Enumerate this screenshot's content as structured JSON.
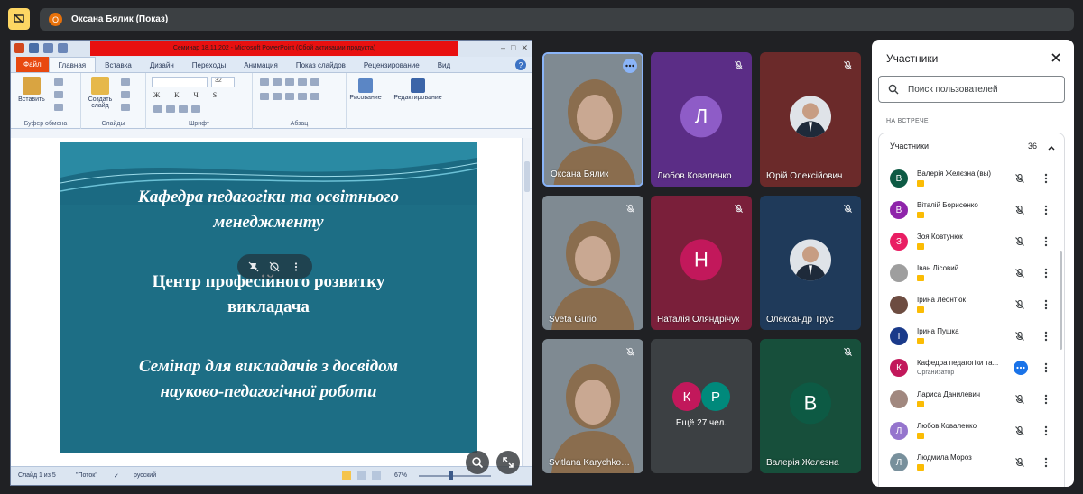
{
  "topbar": {
    "presenter_initial": "О",
    "presenter_label": "Оксана Бялик (Показ)"
  },
  "powerpoint": {
    "window_title": "Семинар     18.11.202  -  Microsoft PowerPoint (Сбой активации продукта)",
    "tabs": [
      "Файл",
      "Главная",
      "Вставка",
      "Дизайн",
      "Переходы",
      "Анимация",
      "Показ слайдов",
      "Рецензирование",
      "Вид"
    ],
    "active_tab": "Главная",
    "help": "?",
    "ribbon": {
      "paste": "Вставить",
      "create_slide_l1": "Создать",
      "create_slide_l2": "слайд",
      "drawing": "Рисование",
      "editing": "Редактирование",
      "font_size": "32",
      "groups": [
        "Буфер обмена",
        "Слайды",
        "Шрифт",
        "Абзац"
      ]
    },
    "slide": {
      "line1a": "Кафедра педагогіки та освітнього",
      "line1b": "менеджменту",
      "line2a": "Центр професійного  розвитку",
      "line2b": "викладача",
      "line3a": "Семінар для викладачів з досвідом",
      "line3b": "науково-педагогічної роботи"
    },
    "status": {
      "slide_of": "Слайд 1 из 5",
      "theme": "\"Поток\"",
      "language": "русский",
      "zoom": "67%"
    }
  },
  "tiles": [
    {
      "name": "Оксана Бялик",
      "type": "photo",
      "highlight": true
    },
    {
      "name": "Любов Коваленко",
      "type": "avatar",
      "initial": "Л",
      "bg": "#5b2d86",
      "avatar_color": "#8e5cc7"
    },
    {
      "name": "Юрій Олексійович",
      "type": "photo-small",
      "bg": "#6b2a2a"
    },
    {
      "name": "Sveta Gurio",
      "type": "photo"
    },
    {
      "name": "Наталія Оляндрічук",
      "type": "avatar",
      "initial": "Н",
      "bg": "#7a1f3a",
      "avatar_color": "#c2185b"
    },
    {
      "name": "Олександр Трус",
      "type": "photo-small",
      "bg": "#1f3a5a"
    },
    {
      "name": "Svitlana Karychkovska",
      "type": "photo"
    },
    {
      "name": "Ещё 27 чел.",
      "type": "group",
      "initials": [
        "К",
        "Р"
      ]
    },
    {
      "name": "Валерія Желєзна",
      "type": "avatar",
      "initial": "В",
      "bg": "#174f3b",
      "avatar_color": "#0d5a44"
    }
  ],
  "panel": {
    "title": "Участники",
    "search_placeholder": "Поиск пользователей",
    "section": "НА ВСТРЕЧЕ",
    "group_label": "Участники",
    "group_count": "36",
    "people": [
      {
        "name": "Валерія Желєзна (вы)",
        "initial": "В",
        "color": "#0d5a44",
        "badge": true
      },
      {
        "name": "Віталій Борисенко",
        "initial": "В",
        "color": "#8e24aa",
        "badge": true
      },
      {
        "name": "Зоя Ковтунюк",
        "initial": "З",
        "color": "#e91e63",
        "badge": true
      },
      {
        "name": "Іван Лісовий",
        "initial": "",
        "color": "#9e9e9e",
        "badge": true
      },
      {
        "name": "Ірина Леонтюк",
        "initial": "",
        "color": "#6d4c41",
        "badge": true
      },
      {
        "name": "Ірина Пушка",
        "initial": "І",
        "color": "#1a3a8a",
        "badge": true
      },
      {
        "name": "Кафедра педагогіки та...",
        "initial": "К",
        "color": "#c2185b",
        "role": "Организатор"
      },
      {
        "name": "Лариса Данилевич",
        "initial": "",
        "color": "#a1887f",
        "badge": true
      },
      {
        "name": "Любов Коваленко",
        "initial": "Л",
        "color": "#9575cd",
        "badge": true
      },
      {
        "name": "Людмила Мороз",
        "initial": "Л",
        "color": "#78909c",
        "badge": true
      }
    ]
  }
}
